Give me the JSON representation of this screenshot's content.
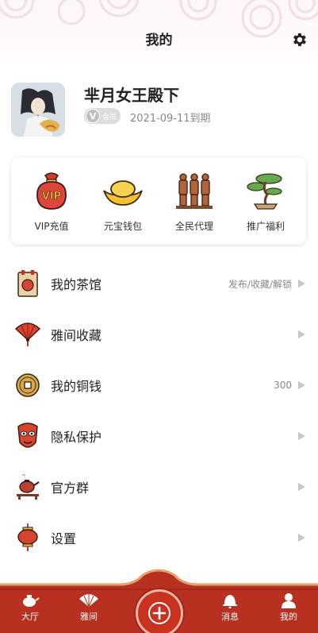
{
  "header": {
    "title": "我的"
  },
  "profile": {
    "username": "芈月女王殿下",
    "badge_text": "会员",
    "expire_text": "2021-09-11到期"
  },
  "quick_actions": [
    {
      "label": "VIP充值",
      "icon": "vip-bag-icon"
    },
    {
      "label": "元宝钱包",
      "icon": "gold-ingot-icon"
    },
    {
      "label": "全民代理",
      "icon": "terracotta-warriors-icon"
    },
    {
      "label": "推广福利",
      "icon": "bonsai-tree-icon"
    }
  ],
  "menu": [
    {
      "label": "我的茶馆",
      "extra": "发布/收藏/解锁",
      "icon": "calendar-scroll-icon"
    },
    {
      "label": "雅间收藏",
      "extra": "",
      "icon": "folding-fan-icon"
    },
    {
      "label": "我的铜钱",
      "extra": "300",
      "icon": "copper-coin-icon"
    },
    {
      "label": "隐私保护",
      "extra": "",
      "icon": "opera-mask-icon"
    },
    {
      "label": "官方群",
      "extra": "",
      "icon": "teapot-icon"
    },
    {
      "label": "设置",
      "extra": "",
      "icon": "lantern-icon"
    }
  ],
  "bottom_nav": [
    {
      "label": "大厅",
      "icon": "teapot-nav-icon"
    },
    {
      "label": "雅间",
      "icon": "fan-nav-icon"
    },
    {
      "label": "",
      "icon": "plus-icon"
    },
    {
      "label": "消息",
      "icon": "bell-icon"
    },
    {
      "label": "我的",
      "icon": "person-nav-icon"
    }
  ],
  "colors": {
    "accent_red": "#c8321f",
    "nav_red": "#b8301f",
    "gold": "#f2c230"
  }
}
